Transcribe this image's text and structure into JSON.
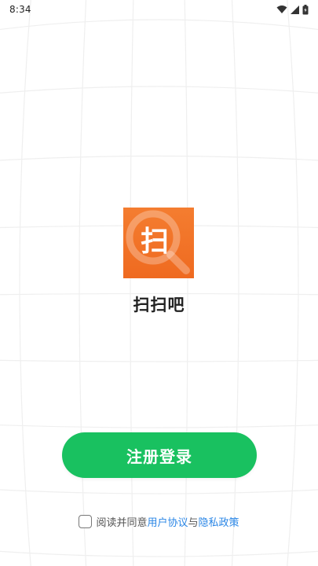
{
  "status_bar": {
    "time": "8:34",
    "icons": [
      "wifi-icon",
      "signal-icon",
      "battery-icon"
    ]
  },
  "app": {
    "logo_char": "扫",
    "name": "扫扫吧"
  },
  "register_button": {
    "label": "注册登录"
  },
  "agreement": {
    "checked": false,
    "prefix": "阅读并同意",
    "user_agreement": "用户协议",
    "conjunction": "与",
    "privacy_policy": "隐私政策"
  },
  "colors": {
    "accent_green": "#19c160",
    "logo_orange": "#f47d30",
    "link_blue": "#2a86e6"
  }
}
